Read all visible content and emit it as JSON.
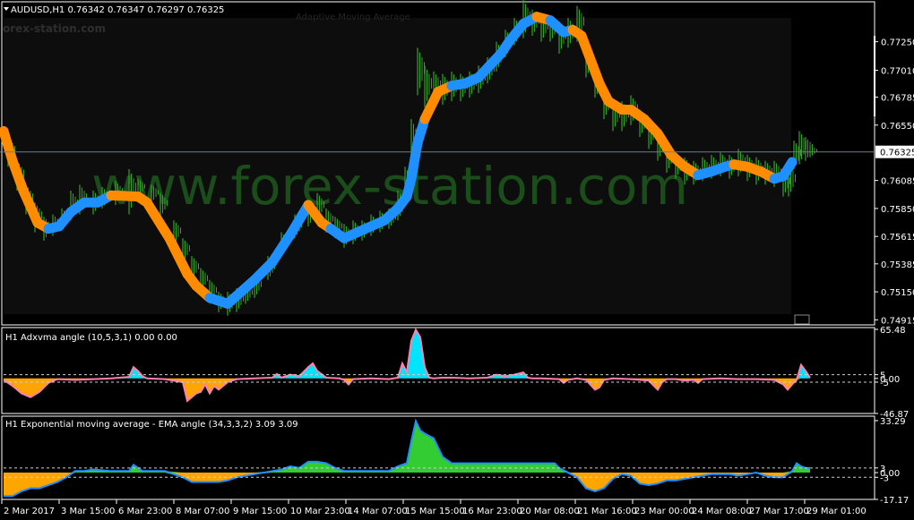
{
  "watermark": {
    "main": "www.forex-station.com",
    "corner": "orex-station.com",
    "ghost_title": "Adaptive Moving Average"
  },
  "colors": {
    "bg": "#000000",
    "border": "#ffffff",
    "candle": "#33a325",
    "up": "#1e90ff",
    "down": "#ff8c00",
    "pink": "#ff7faf",
    "cyan": "#00e5ff",
    "green": "#33cc33",
    "blue_line": "#1e90ff",
    "orange_fill": "#ffa500",
    "price_line": "#6a7f8c",
    "dashed": "#d0d0d0",
    "watermark": "#1a4d1a"
  },
  "main": {
    "symbol_header": "AUDUSD,H1  0.76342 0.76347 0.76297 0.76325",
    "current_price_label": "0.76325",
    "current_price": 0.76325,
    "y_ticks": [
      "0.77250",
      "0.77010",
      "0.76785",
      "0.76550",
      "0.76325",
      "0.76085",
      "0.75850",
      "0.75615",
      "0.75385",
      "0.75150",
      "0.74915"
    ]
  },
  "sub1": {
    "header": "H1 Adxvma angle (10,5,3,1) 0.00 0.00",
    "y_ticks": [
      "65.48",
      "5",
      "0.00",
      "-5",
      "-46.87"
    ]
  },
  "sub2": {
    "header": "H1 Exponential moving average - EMA angle (34,3,3,2) 3.09 3.09",
    "y_ticks": [
      "33.29",
      "3",
      "0.00",
      "-3",
      "-17.17"
    ]
  },
  "x_ticks": [
    "2 Mar 2017",
    "3 Mar 15:00",
    "6 Mar 23:00",
    "8 Mar 07:00",
    "9 Mar 15:00",
    "10 Mar 23:00",
    "14 Mar 07:00",
    "15 Mar 15:00",
    "16 Mar 23:00",
    "20 Mar 08:00",
    "21 Mar 16:00",
    "23 Mar 00:00",
    "24 Mar 08:00",
    "27 Mar 17:00",
    "29 Mar 01:00"
  ],
  "chart_data": [
    {
      "type": "line",
      "title": "AUDUSD,H1",
      "ylim": [
        0.7488,
        0.7745
      ],
      "series": [
        {
          "name": "Adaptive MA",
          "x": [
            0,
            10,
            22,
            38,
            50,
            62,
            75,
            90,
            105,
            120,
            150,
            160,
            185,
            205,
            215,
            230,
            250,
            265,
            280,
            300,
            320,
            340,
            355,
            365,
            380,
            395,
            410,
            425,
            440,
            450,
            455,
            462,
            470,
            485,
            500,
            515,
            530,
            540,
            555,
            565,
            580,
            595,
            610,
            625,
            635,
            645,
            655,
            665,
            675,
            690,
            700,
            715,
            730,
            745,
            760,
            775,
            790,
            805,
            815,
            830,
            845,
            860,
            870,
            880
          ],
          "y": [
            0.765,
            0.7625,
            0.76,
            0.7573,
            0.7568,
            0.757,
            0.7582,
            0.759,
            0.759,
            0.7596,
            0.7595,
            0.759,
            0.756,
            0.753,
            0.752,
            0.751,
            0.7505,
            0.7515,
            0.7525,
            0.754,
            0.7563,
            0.7588,
            0.7573,
            0.7568,
            0.756,
            0.7565,
            0.757,
            0.7575,
            0.7585,
            0.7595,
            0.761,
            0.764,
            0.766,
            0.7683,
            0.7688,
            0.769,
            0.7695,
            0.7703,
            0.7715,
            0.7726,
            0.774,
            0.7746,
            0.7743,
            0.7733,
            0.7735,
            0.773,
            0.771,
            0.769,
            0.7675,
            0.7668,
            0.7668,
            0.766,
            0.7648,
            0.763,
            0.762,
            0.7613,
            0.7616,
            0.762,
            0.7622,
            0.762,
            0.7616,
            0.761,
            0.7612,
            0.7624
          ],
          "colors": [
            "down",
            "down",
            "down",
            "down",
            "up",
            "up",
            "up",
            "up",
            "up",
            "down",
            "down",
            "down",
            "down",
            "down",
            "down",
            "up",
            "up",
            "up",
            "up",
            "up",
            "up",
            "down",
            "down",
            "up",
            "up",
            "up",
            "up",
            "up",
            "up",
            "up",
            "up",
            "up",
            "down",
            "down",
            "up",
            "up",
            "up",
            "up",
            "up",
            "up",
            "up",
            "down",
            "up",
            "up",
            "down",
            "down",
            "down",
            "down",
            "down",
            "down",
            "down",
            "down",
            "down",
            "down",
            "down",
            "up",
            "up",
            "up",
            "down",
            "down",
            "down",
            "up",
            "up",
            "up"
          ]
        }
      ],
      "candles": [
        [
          5,
          0.762,
          0.7645
        ],
        [
          15,
          0.76,
          0.7625
        ],
        [
          25,
          0.758,
          0.7605
        ],
        [
          35,
          0.7565,
          0.759
        ],
        [
          45,
          0.7558,
          0.7578
        ],
        [
          55,
          0.7562,
          0.758
        ],
        [
          65,
          0.7568,
          0.7585
        ],
        [
          75,
          0.7575,
          0.76
        ],
        [
          85,
          0.758,
          0.7605
        ],
        [
          100,
          0.758,
          0.76
        ],
        [
          110,
          0.7585,
          0.7603
        ],
        [
          125,
          0.7588,
          0.7608
        ],
        [
          140,
          0.758,
          0.7618
        ],
        [
          150,
          0.7595,
          0.761
        ],
        [
          165,
          0.759,
          0.7605
        ],
        [
          175,
          0.7578,
          0.7598
        ],
        [
          190,
          0.7555,
          0.7575
        ],
        [
          200,
          0.754,
          0.756
        ],
        [
          210,
          0.7525,
          0.7545
        ],
        [
          220,
          0.7515,
          0.7535
        ],
        [
          230,
          0.7505,
          0.7525
        ],
        [
          240,
          0.7498,
          0.7515
        ],
        [
          250,
          0.7495,
          0.7515
        ],
        [
          260,
          0.7498,
          0.7518
        ],
        [
          270,
          0.7505,
          0.7522
        ],
        [
          280,
          0.751,
          0.753
        ],
        [
          295,
          0.7525,
          0.7545
        ],
        [
          310,
          0.7545,
          0.7565
        ],
        [
          325,
          0.756,
          0.758
        ],
        [
          340,
          0.757,
          0.759
        ],
        [
          350,
          0.7575,
          0.7598
        ],
        [
          360,
          0.7565,
          0.7585
        ],
        [
          370,
          0.756,
          0.7578
        ],
        [
          380,
          0.7552,
          0.7572
        ],
        [
          390,
          0.7555,
          0.7575
        ],
        [
          400,
          0.7558,
          0.7575
        ],
        [
          410,
          0.7562,
          0.758
        ],
        [
          420,
          0.7565,
          0.7583
        ],
        [
          430,
          0.7568,
          0.7585
        ],
        [
          440,
          0.7575,
          0.76
        ],
        [
          448,
          0.759,
          0.762
        ],
        [
          455,
          0.762,
          0.766
        ],
        [
          462,
          0.768,
          0.772
        ],
        [
          470,
          0.767,
          0.7705
        ],
        [
          480,
          0.7675,
          0.77
        ],
        [
          490,
          0.7672,
          0.7698
        ],
        [
          500,
          0.7675,
          0.77
        ],
        [
          510,
          0.7675,
          0.7698
        ],
        [
          520,
          0.7678,
          0.77
        ],
        [
          530,
          0.7682,
          0.7705
        ],
        [
          540,
          0.769,
          0.7712
        ],
        [
          550,
          0.77,
          0.7725
        ],
        [
          560,
          0.7712,
          0.7735
        ],
        [
          570,
          0.7722,
          0.7745
        ],
        [
          580,
          0.7728,
          0.776
        ],
        [
          590,
          0.773,
          0.7752
        ],
        [
          600,
          0.7725,
          0.7748
        ],
        [
          610,
          0.7725,
          0.7745
        ],
        [
          620,
          0.7715,
          0.7742
        ],
        [
          630,
          0.772,
          0.7745
        ],
        [
          640,
          0.7725,
          0.7755
        ],
        [
          650,
          0.7695,
          0.772
        ],
        [
          660,
          0.7678,
          0.77
        ],
        [
          670,
          0.766,
          0.7685
        ],
        [
          680,
          0.765,
          0.7675
        ],
        [
          690,
          0.765,
          0.7675
        ],
        [
          700,
          0.7655,
          0.768
        ],
        [
          710,
          0.7645,
          0.7668
        ],
        [
          720,
          0.7635,
          0.766
        ],
        [
          730,
          0.7625,
          0.765
        ],
        [
          740,
          0.7615,
          0.764
        ],
        [
          750,
          0.761,
          0.7632
        ],
        [
          760,
          0.7605,
          0.7628
        ],
        [
          770,
          0.7605,
          0.7625
        ],
        [
          780,
          0.7608,
          0.7628
        ],
        [
          790,
          0.761,
          0.763
        ],
        [
          800,
          0.7612,
          0.7632
        ],
        [
          810,
          0.761,
          0.763
        ],
        [
          820,
          0.7612,
          0.7635
        ],
        [
          830,
          0.7608,
          0.763
        ],
        [
          840,
          0.7605,
          0.7628
        ],
        [
          850,
          0.7605,
          0.7625
        ],
        [
          860,
          0.7603,
          0.7625
        ],
        [
          870,
          0.7595,
          0.7618
        ],
        [
          876,
          0.7595,
          0.7622
        ],
        [
          882,
          0.7618,
          0.7642
        ],
        [
          888,
          0.7622,
          0.765
        ],
        [
          895,
          0.7625,
          0.7645
        ],
        [
          900,
          0.7628,
          0.7638
        ]
      ]
    },
    {
      "type": "area",
      "title": "H1 Adxvma angle (10,5,3,1)",
      "ylim": [
        -46.87,
        65.48
      ],
      "levels": [
        5,
        -5
      ],
      "series": [
        {
          "name": "Adxvma angle",
          "x": [
            0,
            10,
            20,
            30,
            40,
            50,
            60,
            80,
            100,
            120,
            140,
            145,
            150,
            155,
            160,
            180,
            200,
            205,
            210,
            215,
            220,
            225,
            230,
            235,
            240,
            250,
            260,
            280,
            300,
            305,
            310,
            320,
            330,
            340,
            345,
            350,
            360,
            375,
            380,
            385,
            390,
            410,
            430,
            440,
            445,
            450,
            455,
            460,
            465,
            470,
            475,
            480,
            490,
            500,
            520,
            540,
            550,
            560,
            570,
            580,
            585,
            590,
            600,
            620,
            625,
            630,
            640,
            650,
            660,
            665,
            670,
            680,
            700,
            720,
            730,
            735,
            740,
            750,
            760,
            770,
            775,
            780,
            800,
            820,
            840,
            860,
            870,
            875,
            880,
            885,
            890,
            895,
            900
          ],
          "y": [
            -2,
            -10,
            -20,
            -25,
            -18,
            -6,
            -1,
            -2,
            -1,
            0,
            2,
            15,
            10,
            3,
            0,
            -1,
            -5,
            -30,
            -25,
            -20,
            -18,
            -8,
            -20,
            -10,
            -15,
            -5,
            -1,
            0,
            1,
            6,
            1,
            5,
            3,
            15,
            20,
            10,
            1,
            0,
            -2,
            -8,
            -1,
            0,
            -1,
            1,
            20,
            8,
            50,
            65,
            55,
            15,
            1,
            0,
            1,
            1,
            0,
            1,
            5,
            3,
            5,
            8,
            1,
            0,
            0,
            -1,
            -6,
            -2,
            0,
            -2,
            -15,
            -12,
            -2,
            0,
            -1,
            -3,
            -15,
            -5,
            -1,
            -1,
            -3,
            -2,
            -6,
            -1,
            0,
            -1,
            -1,
            -2,
            -8,
            -15,
            -8,
            -2,
            18,
            10,
            1
          ]
        }
      ]
    },
    {
      "type": "area",
      "title": "H1 Exponential moving average - EMA angle (34,3,3,2)",
      "ylim": [
        -17.17,
        33.29
      ],
      "levels": [
        3,
        -3
      ],
      "series": [
        {
          "name": "EMA angle",
          "x": [
            0,
            10,
            20,
            30,
            40,
            50,
            60,
            70,
            75,
            80,
            90,
            100,
            120,
            140,
            145,
            150,
            155,
            160,
            170,
            180,
            200,
            210,
            220,
            230,
            240,
            250,
            260,
            270,
            280,
            300,
            310,
            320,
            330,
            340,
            350,
            360,
            370,
            380,
            400,
            420,
            430,
            440,
            450,
            455,
            460,
            465,
            470,
            480,
            490,
            500,
            520,
            540,
            560,
            580,
            600,
            615,
            620,
            630,
            640,
            650,
            660,
            670,
            680,
            690,
            700,
            710,
            720,
            730,
            740,
            750,
            760,
            770,
            780,
            790,
            800,
            810,
            820,
            830,
            840,
            850,
            860,
            870,
            880,
            885,
            890,
            895,
            900
          ],
          "y": [
            -15,
            -15,
            -12,
            -10,
            -10,
            -8,
            -6,
            -3,
            -1,
            1,
            1,
            2,
            1,
            1,
            5,
            3,
            1,
            1,
            1,
            1,
            -3,
            -6,
            -6,
            -6,
            -6,
            -5,
            -3,
            -2,
            -1,
            1,
            2,
            4,
            3,
            7,
            7,
            6,
            3,
            1,
            1,
            1,
            1,
            4,
            6,
            20,
            33,
            27,
            25,
            22,
            10,
            6,
            6,
            6,
            6,
            6,
            6,
            6,
            3,
            0,
            -3,
            -10,
            -12,
            -10,
            -4,
            -1,
            -2,
            -7,
            -8,
            -7,
            -5,
            -5,
            -4,
            -3,
            -2,
            -1,
            -1,
            -1,
            -2,
            -1,
            0,
            -2,
            -3,
            -3,
            1,
            6,
            4,
            3,
            3
          ]
        }
      ]
    }
  ]
}
